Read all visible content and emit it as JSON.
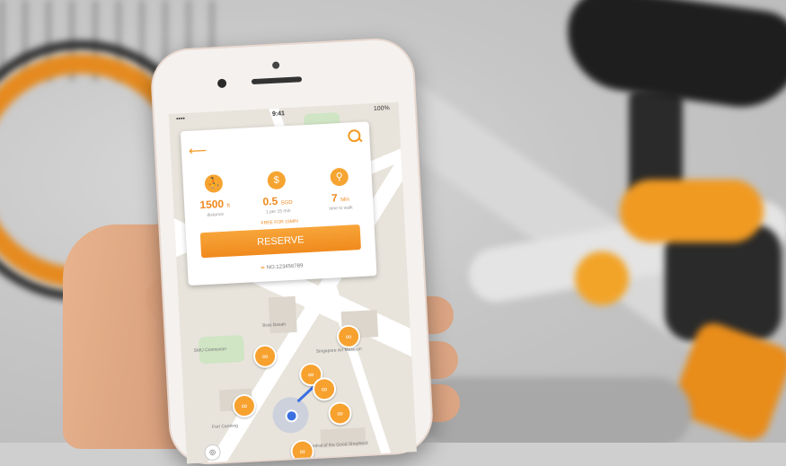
{
  "phone_status": {
    "time": "9:41",
    "carrier": "•••• ",
    "battery": "100%"
  },
  "card": {
    "stats": [
      {
        "value": "1500",
        "unit": "ft",
        "caption": "distance"
      },
      {
        "value": "0.5",
        "unit": "SGD",
        "caption": "1 per 15 min"
      },
      {
        "value": "7",
        "unit": "Min",
        "caption": "time to walk"
      }
    ],
    "free_text": "FREE FOR 15MIN",
    "reserve_label": "RESERVE",
    "bike_id": "NO.123456789"
  },
  "map_labels": [
    "Bras Basah",
    "Singapore Art Museum",
    "Cathedral of the Good Shepherd",
    "Fort Canning",
    "SMU Connexion"
  ],
  "colors": {
    "accent": "#F39A21",
    "location_blue": "#3A6FE0"
  },
  "icons": [
    "back-arrow-icon",
    "search-icon",
    "walk-icon",
    "coin-icon",
    "bike-icon"
  ]
}
